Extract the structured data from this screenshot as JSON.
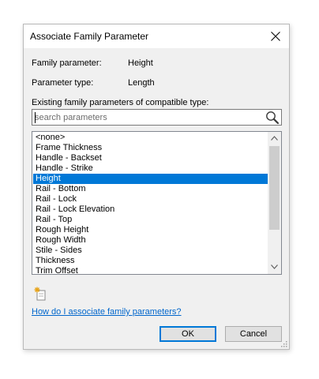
{
  "dialog": {
    "title": "Associate Family Parameter",
    "close_glyph": "close-icon"
  },
  "fields": {
    "family_parameter_label": "Family parameter:",
    "family_parameter_value": "Height",
    "parameter_type_label": "Parameter type:",
    "parameter_type_value": "Length",
    "existing_label": "Existing family parameters of compatible type:"
  },
  "search": {
    "placeholder": "search parameters",
    "value": "",
    "icon": "magnifier-icon"
  },
  "parameters": {
    "items": [
      "<none>",
      "Frame Thickness",
      "Handle - Backset",
      "Handle - Strike",
      "Height",
      "Rail - Bottom",
      "Rail - Lock",
      "Rail - Lock Elevation",
      "Rail - Top",
      "Rough Height",
      "Rough Width",
      "Stile - Sides",
      "Thickness",
      "Trim Offset"
    ],
    "selected": "Height"
  },
  "new_parameter_icon": "new-parameter-icon",
  "help": {
    "link_text": "How do I associate family parameters?"
  },
  "buttons": {
    "ok": "OK",
    "cancel": "Cancel"
  },
  "colors": {
    "selection": "#0078d7",
    "link": "#0066cc",
    "dialog_bg": "#f0f0f0"
  }
}
